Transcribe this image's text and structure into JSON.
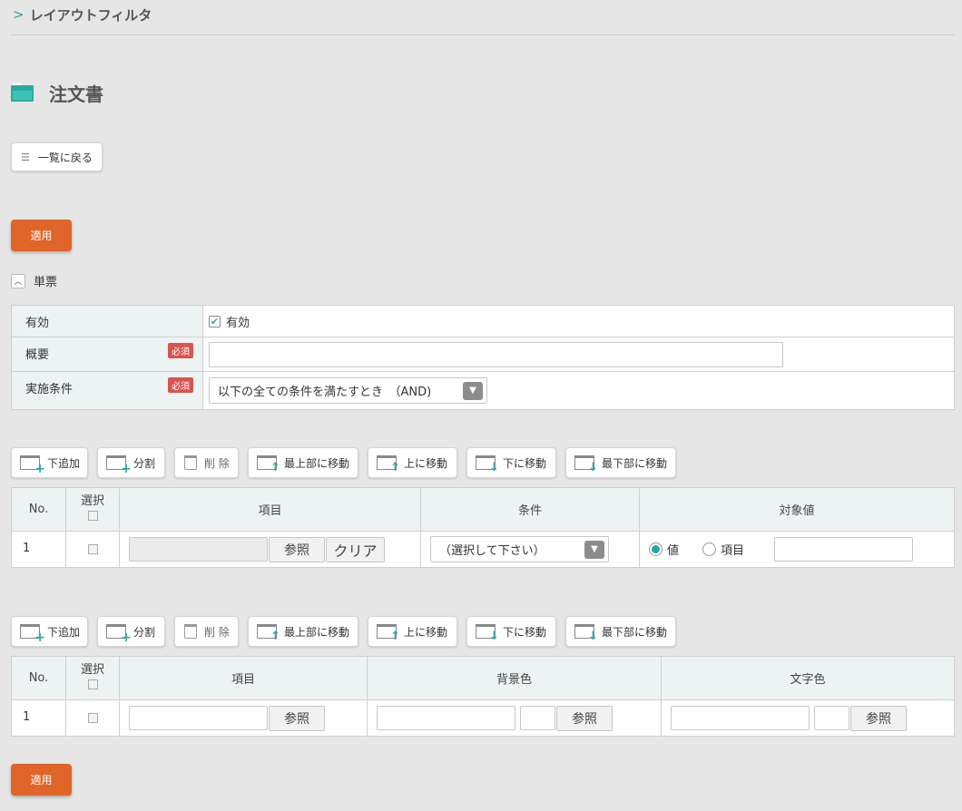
{
  "breadcrumb": {
    "label": "レイアウトフィルタ"
  },
  "page": {
    "title": "注文書"
  },
  "buttons": {
    "back": "一覧に戻る",
    "apply_top": "適用",
    "apply_bottom": "適用"
  },
  "section": {
    "label": "単票"
  },
  "form": {
    "enabled": {
      "label": "有効",
      "value_label": "有効",
      "checked": true
    },
    "summary": {
      "label": "概要",
      "required": "必須",
      "value": ""
    },
    "condition": {
      "label": "実施条件",
      "required": "必須",
      "selected": "以下の全ての条件を満たすとき　（AND)"
    }
  },
  "toolbar": {
    "add_below": "下追加",
    "split": "分割",
    "delete": "削 除",
    "move_top": "最上部に移動",
    "move_up": "上に移動",
    "move_down": "下に移動",
    "move_bottom": "最下部に移動"
  },
  "conditions_table": {
    "headers": {
      "no": "No.",
      "select": "選択",
      "item": "項目",
      "condition": "条件",
      "target": "対象値"
    },
    "rows": [
      {
        "no": "1",
        "ref": "参照",
        "clear": "クリア",
        "condition_placeholder": "（選択して下さい）",
        "radio_value": "値",
        "radio_item": "項目",
        "target_value": ""
      }
    ]
  },
  "colors_table": {
    "headers": {
      "no": "No.",
      "select": "選択",
      "item": "項目",
      "bg_color": "背景色",
      "text_color": "文字色"
    },
    "rows": [
      {
        "no": "1",
        "ref_item": "参照",
        "ref_bg": "参照",
        "ref_text": "参照"
      }
    ]
  },
  "colors": {
    "accent": "#2aa9a0",
    "primary_button": "#df6528",
    "required_badge": "#d9534f"
  }
}
